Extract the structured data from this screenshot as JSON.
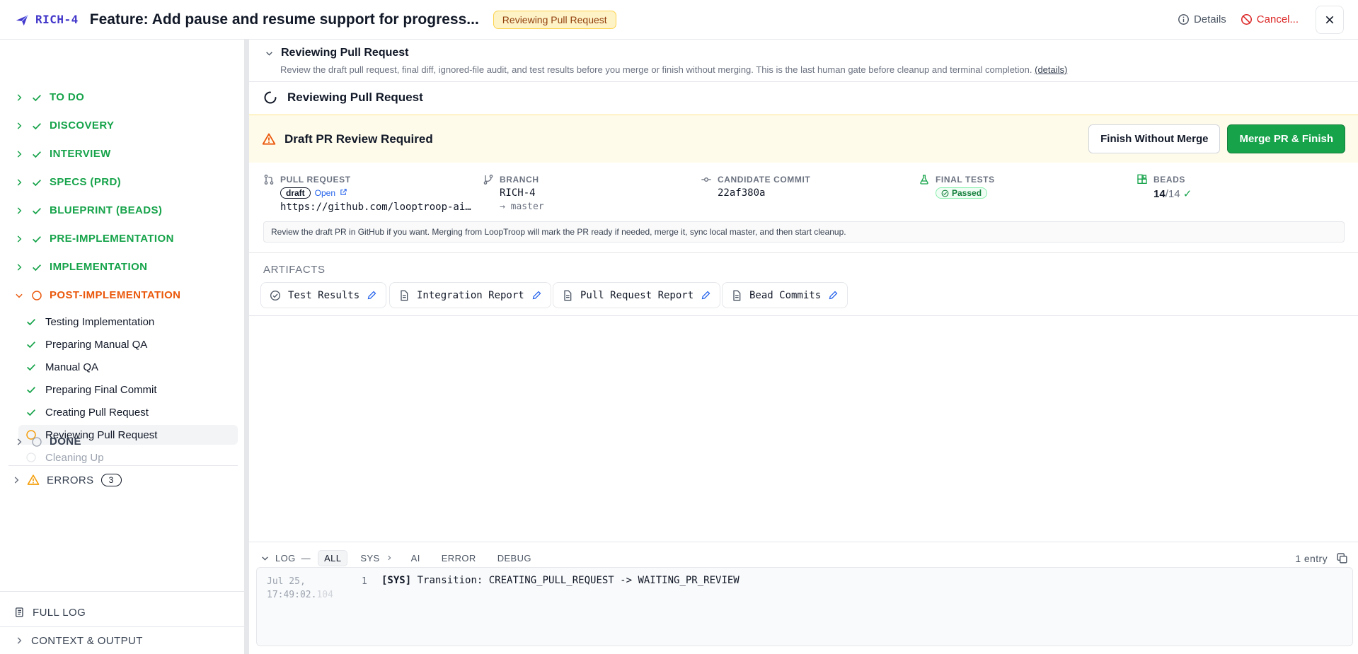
{
  "header": {
    "ticket": "RICH-4",
    "title": "Feature: Add pause and resume support for progress...",
    "status_badge": "Reviewing Pull Request",
    "details_label": "Details",
    "cancel_label": "Cancel..."
  },
  "sidebar": {
    "phases": [
      {
        "label": "TO DO",
        "state": "done"
      },
      {
        "label": "DISCOVERY",
        "state": "done"
      },
      {
        "label": "INTERVIEW",
        "state": "done"
      },
      {
        "label": "SPECS (PRD)",
        "state": "done"
      },
      {
        "label": "BLUEPRINT (BEADS)",
        "state": "done"
      },
      {
        "label": "PRE-IMPLEMENTATION",
        "state": "done"
      },
      {
        "label": "IMPLEMENTATION",
        "state": "done"
      },
      {
        "label": "POST-IMPLEMENTATION",
        "state": "active"
      }
    ],
    "post_steps": [
      {
        "label": "Testing Implementation",
        "state": "done"
      },
      {
        "label": "Preparing Manual QA",
        "state": "done"
      },
      {
        "label": "Manual QA",
        "state": "done"
      },
      {
        "label": "Preparing Final Commit",
        "state": "done"
      },
      {
        "label": "Creating Pull Request",
        "state": "done"
      },
      {
        "label": "Reviewing Pull Request",
        "state": "current"
      },
      {
        "label": "Cleaning Up",
        "state": "future"
      }
    ],
    "done_phase": "DONE",
    "errors_label": "ERRORS",
    "errors_count": "3",
    "full_log_label": "FULL LOG",
    "context_label": "CONTEXT & OUTPUT"
  },
  "main": {
    "section_title": "Reviewing Pull Request",
    "section_desc": "Review the draft pull request, final diff, ignored-file audit, and test results before you merge or finish without merging. This is the last human gate before cleanup and terminal completion.",
    "details_link": "(details)",
    "status_title": "Reviewing Pull Request",
    "review_title": "Draft PR Review Required",
    "finish_without_merge": "Finish Without Merge",
    "merge_finish": "Merge PR & Finish",
    "pull_request": {
      "label": "PULL REQUEST",
      "draft": "draft",
      "open": "Open",
      "url": "https://github.com/looptroop-ai…"
    },
    "branch": {
      "label": "BRANCH",
      "name": "RICH-4",
      "target": "→ master"
    },
    "commit": {
      "label": "CANDIDATE COMMIT",
      "hash": "22af380a"
    },
    "final_tests": {
      "label": "FINAL TESTS",
      "status": "Passed"
    },
    "beads": {
      "label": "BEADS",
      "done": "14",
      "total": "/14",
      "check": "✓"
    },
    "note": "Review the draft PR in GitHub if you want. Merging from LoopTroop will mark the PR ready if needed, merge it, sync local master, and then start cleanup.",
    "artifacts_title": "ARTIFACTS",
    "artifacts": [
      {
        "label": "Test Results",
        "icon": "check-circle-icon"
      },
      {
        "label": "Integration Report",
        "icon": "document-icon"
      },
      {
        "label": "Pull Request Report",
        "icon": "document-icon"
      },
      {
        "label": "Bead Commits",
        "icon": "document-icon"
      }
    ]
  },
  "log": {
    "label": "LOG",
    "separator": "—",
    "tabs": [
      "ALL",
      "SYS",
      "AI",
      "ERROR",
      "DEBUG"
    ],
    "count": "1 entry",
    "entry": {
      "date": "Jul 25,",
      "time": "17:49:02.",
      "ms": "104",
      "num": "1",
      "tag": "[SYS]",
      "msg": " Transition: CREATING_PULL_REQUEST -> WAITING_PR_REVIEW"
    }
  },
  "colors": {
    "done": "#16a34a",
    "active": "#ea580c",
    "primary_button": "#16a34a",
    "accent_link": "#2563eb"
  }
}
